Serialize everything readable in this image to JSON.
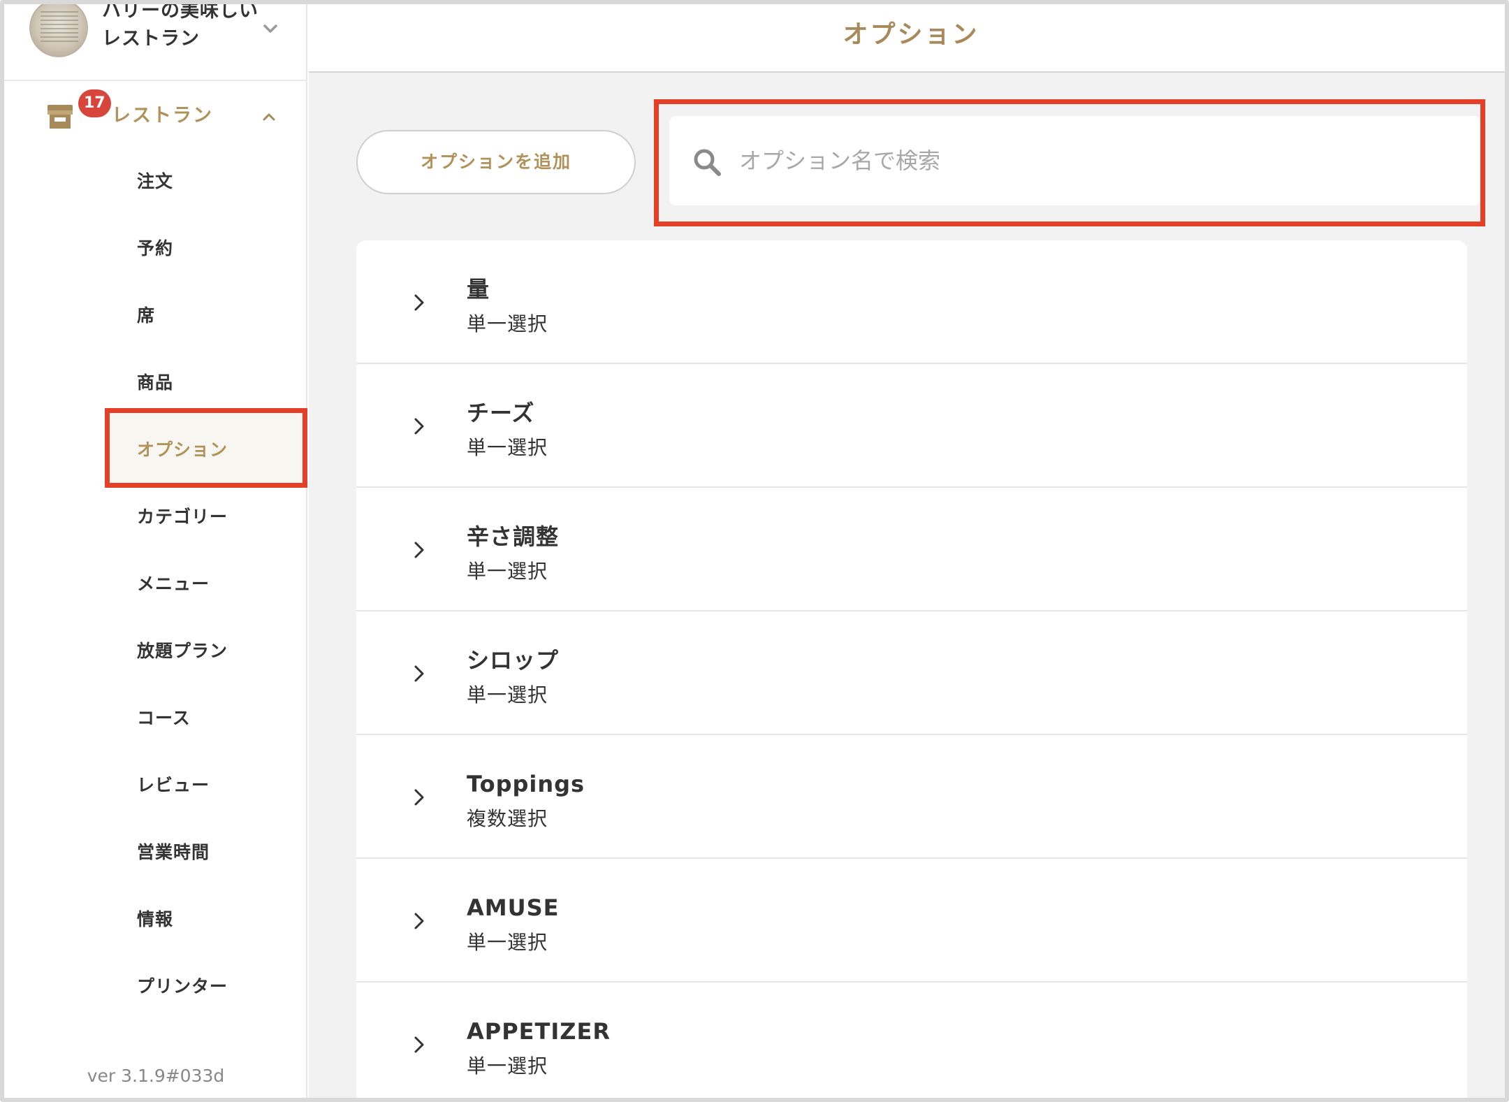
{
  "store": {
    "name_line1": "ハリーの美味しい",
    "name_line2": "レストラン"
  },
  "sidebar": {
    "group_label": "レストラン",
    "badge_count": "17",
    "items": [
      {
        "label": "注文"
      },
      {
        "label": "予約"
      },
      {
        "label": "席"
      },
      {
        "label": "商品"
      },
      {
        "label": "オプション",
        "active": true
      },
      {
        "label": "カテゴリー"
      },
      {
        "label": "メニュー"
      },
      {
        "label": "放題プラン"
      },
      {
        "label": "コース"
      },
      {
        "label": "レビュー"
      },
      {
        "label": "営業時間"
      },
      {
        "label": "情報"
      },
      {
        "label": "プリンター"
      }
    ],
    "version": "ver 3.1.9#033d"
  },
  "header": {
    "title": "オプション"
  },
  "toolbar": {
    "add_label": "オプションを追加",
    "search_placeholder": "オプション名で検索",
    "search_value": ""
  },
  "options": [
    {
      "name": "量",
      "type": "単一選択"
    },
    {
      "name": "チーズ",
      "type": "単一選択"
    },
    {
      "name": "辛さ調整",
      "type": "単一選択"
    },
    {
      "name": "シロップ",
      "type": "単一選択"
    },
    {
      "name": "Toppings",
      "type": "複数選択"
    },
    {
      "name": "AMUSE",
      "type": "単一選択"
    },
    {
      "name": "APPETIZER",
      "type": "単一選択"
    }
  ],
  "colors": {
    "accent": "#b0925a",
    "highlight": "#e34027",
    "badge": "#d8453b"
  },
  "icons": {
    "store_toggle": "chevron-down-icon",
    "group_toggle": "chevron-up-icon",
    "shop": "shop-icon",
    "search": "search-icon",
    "row_expand": "chevron-right-icon"
  }
}
